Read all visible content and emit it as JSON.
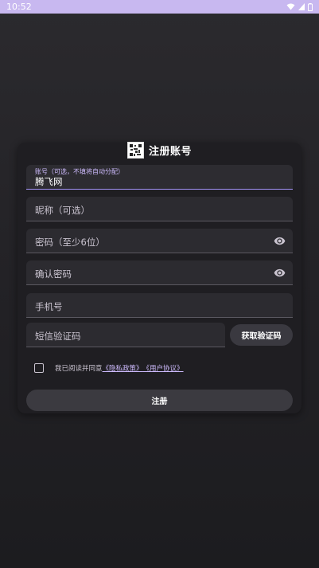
{
  "status_bar": {
    "time": "10:52"
  },
  "header": {
    "title": "注册账号"
  },
  "form": {
    "account": {
      "label": "账号（可选，不填将自动分配）",
      "value": "腾飞网"
    },
    "nickname": {
      "placeholder": "昵称（可选）"
    },
    "password": {
      "placeholder": "密码（至少6位）"
    },
    "confirm_password": {
      "placeholder": "确认密码"
    },
    "phone": {
      "placeholder": "手机号"
    },
    "sms_code": {
      "placeholder": "短信验证码"
    },
    "get_code_label": "获取验证码",
    "agreement": {
      "prefix": "我已阅读并同意",
      "privacy": "《隐私政策》",
      "terms": "《用户协议》"
    },
    "submit_label": "注册"
  },
  "colors": {
    "accent": "#cfbcff",
    "status_bar": "#c8b8f0",
    "card": "#1f1e22"
  }
}
